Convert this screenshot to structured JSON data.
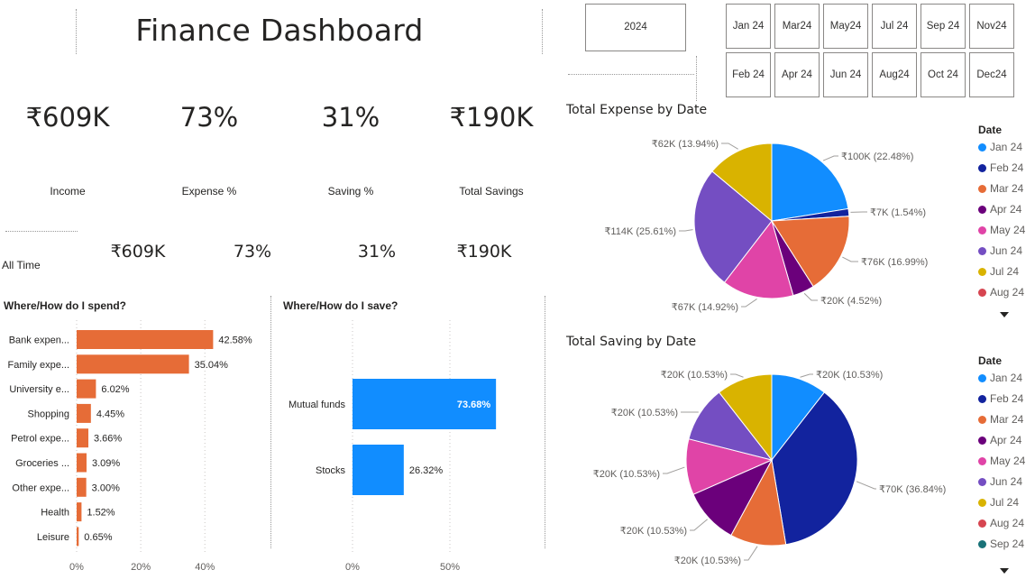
{
  "header": {
    "title": "Finance Dashboard"
  },
  "kpis": [
    {
      "value": "₹609K",
      "label": "Income"
    },
    {
      "value": "73%",
      "label": "Expense %"
    },
    {
      "value": "31%",
      "label": "Saving %"
    },
    {
      "value": "₹190K",
      "label": "Total Savings"
    }
  ],
  "all_time": {
    "label": "All Time",
    "values": [
      "₹609K",
      "73%",
      "31%",
      "₹190K"
    ]
  },
  "year_slicer": {
    "label": "2024"
  },
  "month_slicer": {
    "row1": [
      "Jan 24",
      "Mar 24",
      "May 24",
      "Jul 24",
      "Sep 24",
      "Nov 24"
    ],
    "row2": [
      "Feb 24",
      "Apr 24",
      "Jun 24",
      "Aug 24",
      "Oct 24",
      "Dec 24"
    ]
  },
  "colors": {
    "bar_orange": "#E66C37",
    "bar_blue": "#118DFF",
    "month_colors": [
      "#118DFF",
      "#12239E",
      "#E66C37",
      "#6B007B",
      "#E044A7",
      "#744EC2",
      "#D9B300",
      "#D64550",
      "#197278"
    ]
  },
  "spend_chart": {
    "title": "Where/How do I spend?",
    "x_ticks": [
      "0%",
      "20%",
      "40%"
    ]
  },
  "save_chart": {
    "title": "Where/How do I save?",
    "x_ticks": [
      "0%",
      "50%"
    ]
  },
  "expense_pie": {
    "title": "Total Expense by Date",
    "legend_title": "Date",
    "legend_items": [
      "Jan 24",
      "Feb 24",
      "Mar 24",
      "Apr 24",
      "May 24",
      "Jun 24",
      "Jul 24",
      "Aug 24"
    ]
  },
  "saving_pie": {
    "title": "Total Saving by Date",
    "legend_title": "Date",
    "legend_items": [
      "Jan 24",
      "Feb 24",
      "Mar 24",
      "Apr 24",
      "May 24",
      "Jun 24",
      "Jul 24",
      "Aug 24",
      "Sep 24"
    ]
  },
  "chart_data": [
    {
      "type": "bar",
      "orientation": "horizontal",
      "title": "Where/How do I spend?",
      "categories": [
        "Bank expen...",
        "Family expe...",
        "University e...",
        "Shopping",
        "Petrol expe...",
        "Groceries ...",
        "Other expe...",
        "Health",
        "Leisure"
      ],
      "values": [
        42.58,
        35.04,
        6.02,
        4.45,
        3.66,
        3.09,
        3.0,
        1.52,
        0.65
      ],
      "data_labels": [
        "42.58%",
        "35.04%",
        "6.02%",
        "4.45%",
        "3.66%",
        "3.09%",
        "3.00%",
        "1.52%",
        "0.65%"
      ],
      "xlim": [
        0,
        45
      ],
      "x_unit": "%"
    },
    {
      "type": "bar",
      "orientation": "horizontal",
      "title": "Where/How do I save?",
      "categories": [
        "Mutual funds",
        "Stocks"
      ],
      "values": [
        73.68,
        26.32
      ],
      "data_labels": [
        "73.68%",
        "26.32%"
      ],
      "xlim": [
        0,
        75
      ],
      "x_unit": "%"
    },
    {
      "type": "pie",
      "title": "Total Expense by Date",
      "categories": [
        "Jan 24",
        "Feb 24",
        "Mar 24",
        "Apr 24",
        "May 24",
        "Jun 24",
        "Jul 24"
      ],
      "values": [
        22.48,
        1.54,
        16.99,
        4.52,
        14.92,
        25.61,
        13.94
      ],
      "data_labels": [
        "₹100K (22.48%)",
        "₹7K (1.54%)",
        "₹76K (16.99%)",
        "₹20K (4.52%)",
        "₹67K (14.92%)",
        "₹114K (25.61%)",
        "₹62K (13.94%)"
      ]
    },
    {
      "type": "pie",
      "title": "Total Saving by Date",
      "categories": [
        "Jan 24",
        "Feb 24",
        "Mar 24",
        "Apr 24",
        "May 24",
        "Jun 24",
        "Jul 24"
      ],
      "values": [
        10.53,
        36.84,
        10.53,
        10.53,
        10.53,
        10.53,
        10.53
      ],
      "data_labels": [
        "₹20K (10.53%)",
        "₹70K (36.84%)",
        "₹20K (10.53%)",
        "₹20K (10.53%)",
        "₹20K (10.53%)",
        "₹20K (10.53%)",
        "₹20K (10.53%)"
      ]
    }
  ]
}
